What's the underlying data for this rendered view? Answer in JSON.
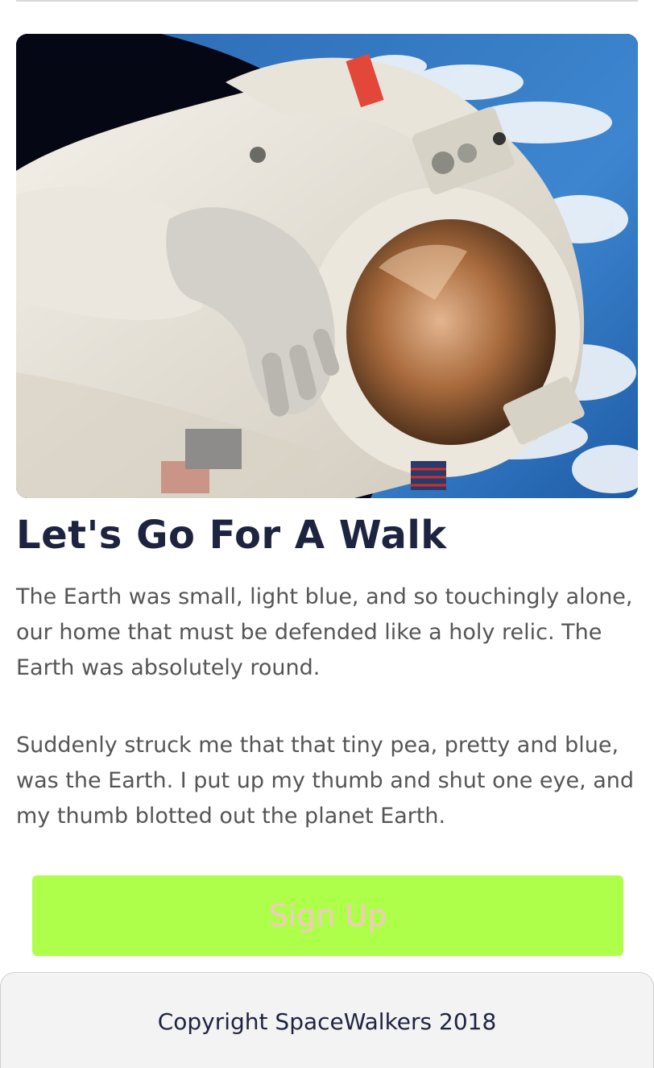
{
  "hero": {
    "image_alt": "Astronaut on a spacewalk above Earth"
  },
  "article": {
    "title": "Let's Go For A Walk",
    "paragraph1": "The Earth was small, light blue, and so touchingly alone, our home that must be defended like a holy relic. The Earth was absolutely round.",
    "paragraph2": "Suddenly struck me that that tiny pea, pretty and blue, was the Earth. I put up my thumb and shut one eye, and my thumb blotted out the planet Earth."
  },
  "cta": {
    "label": "Sign Up",
    "background_color": "#adff4a",
    "text_color": "#f5c7c7"
  },
  "footer": {
    "copyright": "Copyright SpaceWalkers 2018"
  },
  "colors": {
    "heading": "#1e2440",
    "body_text": "#555555",
    "footer_bg": "#f3f3f3"
  }
}
